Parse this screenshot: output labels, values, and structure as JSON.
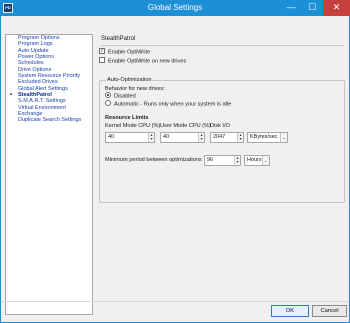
{
  "window": {
    "title": "Global Settings",
    "app_icon": "PD",
    "minimize": "—",
    "maximize": "☐",
    "close": "✕"
  },
  "sidebar": {
    "items": [
      {
        "label": "Program Options",
        "selected": false
      },
      {
        "label": "Program Logs",
        "selected": false
      },
      {
        "label": "Auto Update",
        "selected": false
      },
      {
        "label": "Power Options",
        "selected": false
      },
      {
        "label": "Schedules",
        "selected": false
      },
      {
        "label": "Drive Options",
        "selected": false
      },
      {
        "label": "System Resource Priority",
        "selected": false
      },
      {
        "label": "Excluded Drives",
        "selected": false
      },
      {
        "label": "Global Alert Settings",
        "selected": false
      },
      {
        "label": "StealthPatrol",
        "selected": true
      },
      {
        "label": "S.M.A.R.T. Settings",
        "selected": false
      },
      {
        "label": "Virtual Environment",
        "selected": false
      },
      {
        "label": "Exchange",
        "selected": false
      },
      {
        "label": "Duplicate Search Settings",
        "selected": false
      }
    ],
    "bullet": "•"
  },
  "panel": {
    "title": "StealthPatrol",
    "enable_optiwrite": {
      "label": "Enable OptiWrite",
      "checked": true
    },
    "enable_optiwrite_new": {
      "label": "Enable OptiWrite on new drives",
      "checked": false
    },
    "auto_optimization": {
      "legend": "Auto-Optimization",
      "behavior_label": "Behavior for new drives:",
      "option_disabled": {
        "label": "Disabled",
        "selected": true
      },
      "option_automatic": {
        "label": "Automatic - Runs only when your system is idle",
        "selected": false
      },
      "resource_limits_label": "Resource Limits",
      "kernel_cpu_label": "Kernel Mode CPU (%)",
      "user_cpu_label": "User Mode CPU (%)",
      "disk_io_label": "Disk I/O",
      "kernel_cpu_value": "40",
      "user_cpu_value": "40",
      "disk_io_value": "2047",
      "disk_io_unit": "KBytes/sec",
      "min_period_label": "Minimum period between optimizations",
      "min_period_value": "96",
      "min_period_unit": "Hours"
    }
  },
  "buttons": {
    "ok": "OK",
    "cancel": "Cancel"
  },
  "glyphs": {
    "check": "✓",
    "spin_up": "▲",
    "spin_down": "▼",
    "dropdown": "⌄"
  },
  "colors": {
    "titlebar": "#1c8fd6",
    "link": "#1a3fa8",
    "close_button": "#c74040"
  }
}
